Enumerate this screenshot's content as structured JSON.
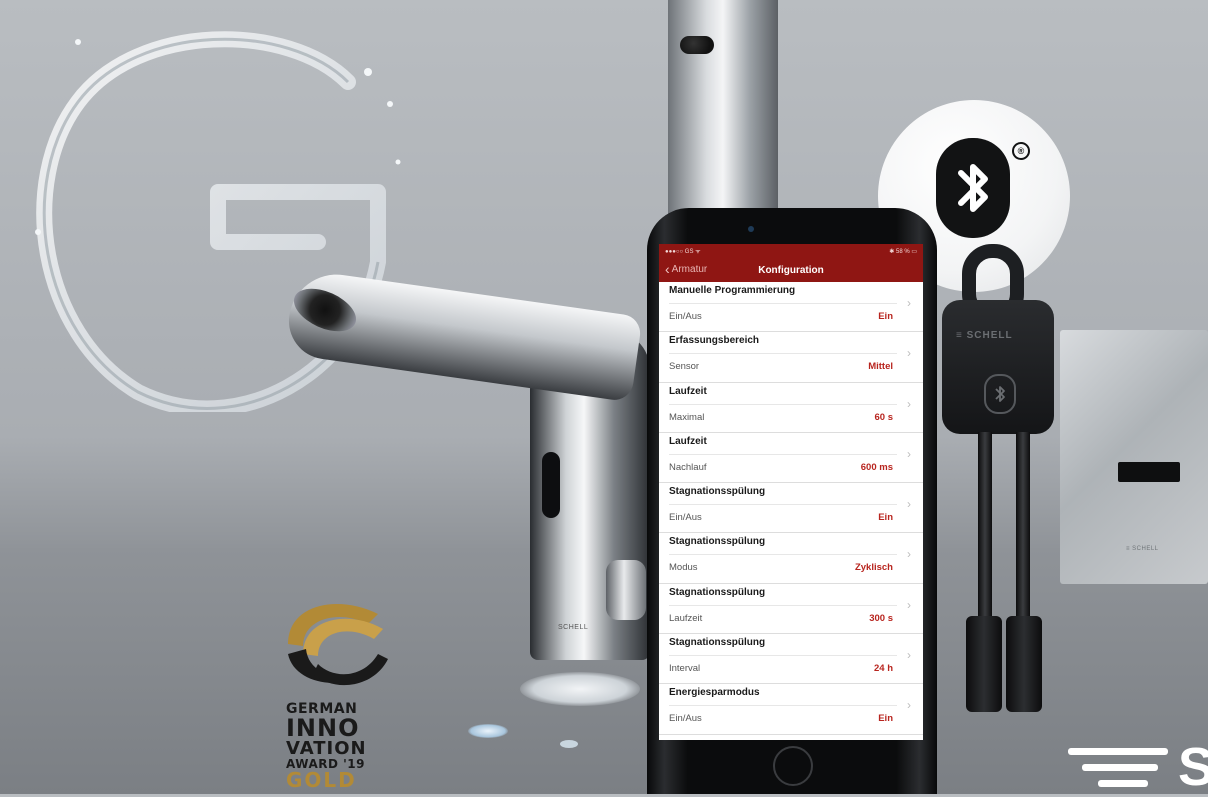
{
  "phone": {
    "status_left": "●●●○○ GS ᯤ",
    "status_right": "✱ 58 % ▭",
    "nav_back_label": "Armatur",
    "nav_title": "Konfiguration",
    "rows": [
      {
        "title": "Manuelle Programmierung",
        "label": "Ein/Aus",
        "value": "Ein"
      },
      {
        "title": "Erfassungsbereich",
        "label": "Sensor",
        "value": "Mittel"
      },
      {
        "title": "Laufzeit",
        "label": "Maximal",
        "value": "60 s"
      },
      {
        "title": "Laufzeit",
        "label": "Nachlauf",
        "value": "600 ms"
      },
      {
        "title": "Stagnationsspülung",
        "label": "Ein/Aus",
        "value": "Ein"
      },
      {
        "title": "Stagnationsspülung",
        "label": "Modus",
        "value": "Zyklisch"
      },
      {
        "title": "Stagnationsspülung",
        "label": "Laufzeit",
        "value": "300 s"
      },
      {
        "title": "Stagnationsspülung",
        "label": "Interval",
        "value": "24 h"
      },
      {
        "title": "Energiesparmodus",
        "label": "Ein/Aus",
        "value": "Ein"
      }
    ]
  },
  "branding": {
    "dongle_brand": "≡ SCHELL",
    "plate_brand": "≡ SCHELL",
    "faucet_brand": "SCHELL",
    "logo_letter": "S"
  },
  "award": {
    "line1": "GERMAN",
    "line2": "INNO",
    "line3": "VATION",
    "line4": "AWARD '19",
    "line5": "GOLD"
  },
  "bluetooth": {
    "registered_mark": "®"
  },
  "icons": {
    "bluetooth": "bluetooth-icon",
    "back": "chevron-left-icon",
    "row_arrow": "chevron-right-icon"
  },
  "colors": {
    "app_header": "#8f1613",
    "value_red": "#b8251f",
    "award_gold": "#b28a36"
  }
}
